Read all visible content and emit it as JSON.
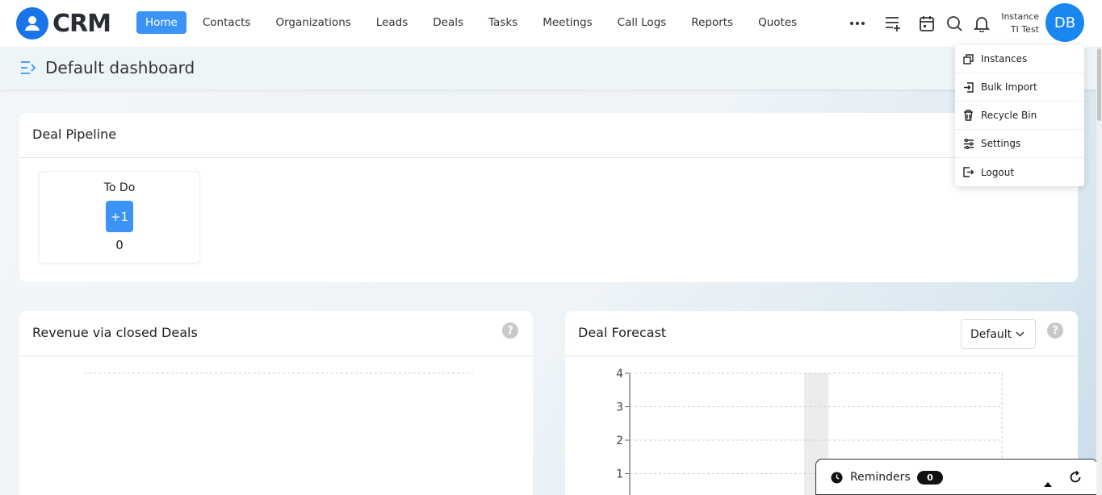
{
  "app": {
    "name": "CRM"
  },
  "nav": {
    "items": [
      {
        "label": "Home",
        "active": true
      },
      {
        "label": "Contacts"
      },
      {
        "label": "Organizations"
      },
      {
        "label": "Leads"
      },
      {
        "label": "Deals"
      },
      {
        "label": "Tasks"
      },
      {
        "label": "Meetings"
      },
      {
        "label": "Call Logs"
      },
      {
        "label": "Reports"
      },
      {
        "label": "Quotes"
      }
    ]
  },
  "toolbar": {
    "icons": [
      "more-icon",
      "add-list-icon",
      "calendar-icon",
      "search-icon",
      "bell-icon"
    ]
  },
  "user": {
    "instance_label": "Instance",
    "instance_name": "TI Test",
    "initials": "DB"
  },
  "page": {
    "title": "Default dashboard"
  },
  "user_menu": {
    "items": [
      {
        "label": "Instances",
        "icon": "copy-icon"
      },
      {
        "label": "Bulk Import",
        "icon": "import-icon"
      },
      {
        "label": "Recycle Bin",
        "icon": "trash-icon"
      },
      {
        "label": "Settings",
        "icon": "sliders-icon"
      },
      {
        "label": "Logout",
        "icon": "logout-icon"
      }
    ]
  },
  "deal_pipeline": {
    "title": "Deal Pipeline",
    "stages": [
      {
        "label": "To Do",
        "button": "+1",
        "count": "0"
      }
    ]
  },
  "revenue_card": {
    "title": "Revenue via closed Deals",
    "help": "?"
  },
  "forecast_card": {
    "title": "Deal Forecast",
    "select_value": "Default",
    "help": "?"
  },
  "chart_data": {
    "type": "bar",
    "y_ticks": [
      "4",
      "3",
      "2",
      "1"
    ],
    "ylim": [
      0,
      4
    ],
    "grid": true
  },
  "reminders": {
    "label": "Reminders",
    "count": "0"
  },
  "colors": {
    "accent": "#3b93f5",
    "brand": "#1a73e8",
    "avatar": "#1a86f0"
  }
}
